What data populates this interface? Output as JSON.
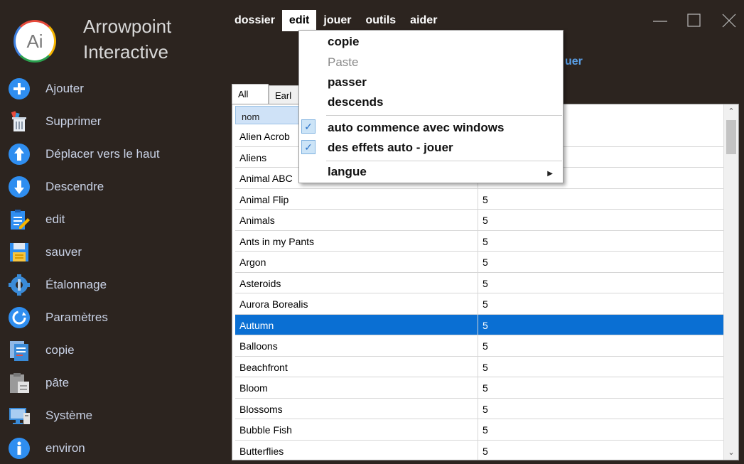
{
  "brand": {
    "logo_text": "Ai",
    "line1": "Arrowpoint",
    "line2": "Interactive"
  },
  "colors": {
    "background": "#2c241f",
    "accent": "#0a6fd3",
    "sidebar_text": "#c9d2e6"
  },
  "sidebar": {
    "items": [
      {
        "label": "Ajouter",
        "icon": "add-icon"
      },
      {
        "label": "Supprimer",
        "icon": "trash-icon"
      },
      {
        "label": "Déplacer vers le haut",
        "icon": "arrow-up-icon"
      },
      {
        "label": "Descendre",
        "icon": "arrow-down-icon"
      },
      {
        "label": "edit",
        "icon": "edit-icon"
      },
      {
        "label": "sauver",
        "icon": "save-icon"
      },
      {
        "label": "Étalonnage",
        "icon": "calibrate-icon"
      },
      {
        "label": "Paramètres",
        "icon": "settings-icon"
      },
      {
        "label": "copie",
        "icon": "copy-icon"
      },
      {
        "label": "pâte",
        "icon": "paste-icon"
      },
      {
        "label": "Système",
        "icon": "system-icon"
      },
      {
        "label": "environ",
        "icon": "info-icon"
      }
    ]
  },
  "menubar": {
    "items": [
      "dossier",
      "edit",
      "jouer",
      "outils",
      "aider"
    ],
    "active": "edit"
  },
  "edit_menu": {
    "copy": "copie",
    "paste": "Paste",
    "skip": "passer",
    "move_down": "descends",
    "autostart": "auto commence avec windows",
    "autoplay": "des effets auto - jouer",
    "language": "langue"
  },
  "peek_text": "uer",
  "tabs": [
    "All",
    "Earl"
  ],
  "table": {
    "headers": [
      "nom"
    ],
    "rows": [
      [
        "Alien Acrob",
        ""
      ],
      [
        "Aliens",
        ""
      ],
      [
        "Animal ABC",
        ""
      ],
      [
        "Animal Flip",
        "5"
      ],
      [
        "Animals",
        "5"
      ],
      [
        "Ants in my Pants",
        "5"
      ],
      [
        "Argon",
        "5"
      ],
      [
        "Asteroids",
        "5"
      ],
      [
        "Aurora Borealis",
        "5"
      ],
      [
        "Autumn",
        "5"
      ],
      [
        "Balloons",
        "5"
      ],
      [
        "Beachfront",
        "5"
      ],
      [
        "Bloom",
        "5"
      ],
      [
        "Blossoms",
        "5"
      ],
      [
        "Bubble Fish",
        "5"
      ],
      [
        "Butterflies",
        "5"
      ]
    ],
    "selected_row": 9
  }
}
